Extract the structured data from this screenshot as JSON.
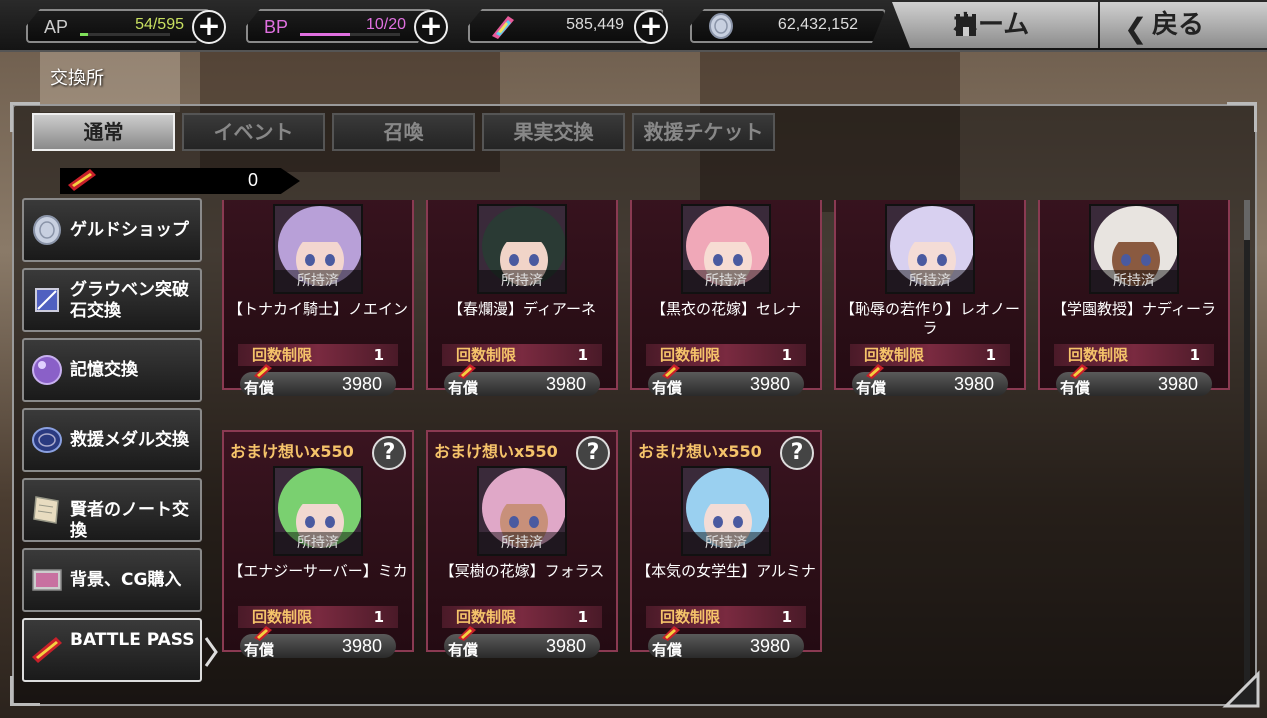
{
  "topbar": {
    "ap": {
      "label": "AP",
      "value": "54/595",
      "color": "#7fe05a",
      "fill": 0.09
    },
    "bp": {
      "label": "BP",
      "value": "10/20",
      "color": "#e070e0",
      "fill": 0.5
    },
    "gems": {
      "value": "585,449",
      "icon": "crystal-icon"
    },
    "gold": {
      "value": "62,432,152",
      "icon": "coin-icon"
    },
    "home_label": "ホーム",
    "back_label": "戻る",
    "plus_label": "+"
  },
  "page_title": "交換所",
  "tabs": [
    {
      "label": "通常",
      "active": true
    },
    {
      "label": "イベント",
      "active": false
    },
    {
      "label": "召喚",
      "active": false
    },
    {
      "label": "果実交換",
      "active": false
    },
    {
      "label": "救援チケット",
      "active": false
    }
  ],
  "ticket": {
    "count": "0",
    "icon": "battle-pass-ticket-icon"
  },
  "sidebar": [
    {
      "label": "ゲルドショップ",
      "icon": "coin-icon"
    },
    {
      "label": "グラウベン突破石交換",
      "icon": "break-stone-icon"
    },
    {
      "label": "記憶交換",
      "icon": "memory-orb-icon"
    },
    {
      "label": "救援メダル交換",
      "icon": "medal-icon"
    },
    {
      "label": "賢者のノート交換",
      "icon": "note-icon"
    },
    {
      "label": "背景、CG購入",
      "icon": "picture-icon"
    },
    {
      "label": "BATTLE PASS",
      "icon": "battle-pass-ticket-icon",
      "active": true
    }
  ],
  "cards": [
    {
      "name": "【トナカイ騎士】ノエイン",
      "owned": "所持済",
      "limit_label": "回数制限",
      "limit": "1",
      "price_type": "有償",
      "price": "3980",
      "bonus": "",
      "hair": "#b8a0d8",
      "skin": "#f3d6cf"
    },
    {
      "name": "【春爛漫】ディアーネ",
      "owned": "所持済",
      "limit_label": "回数制限",
      "limit": "1",
      "price_type": "有償",
      "price": "3980",
      "bonus": "",
      "hair": "#2a3a34",
      "skin": "#f1d4c8"
    },
    {
      "name": "【黒衣の花嫁】セレナ",
      "owned": "所持済",
      "limit_label": "回数制限",
      "limit": "1",
      "price_type": "有償",
      "price": "3980",
      "bonus": "",
      "hair": "#f0a8b8",
      "skin": "#f7dcd3"
    },
    {
      "name": "【恥辱の若作り】レオノーラ",
      "owned": "所持済",
      "limit_label": "回数制限",
      "limit": "1",
      "price_type": "有償",
      "price": "3980",
      "bonus": "",
      "hair": "#d8d0f0",
      "skin": "#f4dcd6"
    },
    {
      "name": "【学園教授】ナディーラ",
      "owned": "所持済",
      "limit_label": "回数制限",
      "limit": "1",
      "price_type": "有償",
      "price": "3980",
      "bonus": "",
      "hair": "#e8e4e0",
      "skin": "#8a5a40"
    },
    {
      "name": "【エナジーサーバー】ミカ",
      "owned": "所持済",
      "limit_label": "回数制限",
      "limit": "1",
      "price_type": "有償",
      "price": "3980",
      "bonus": "おまけ想いx550",
      "help": "?",
      "hair": "#7ad070",
      "skin": "#f1d8d0"
    },
    {
      "name": "【冥樹の花嫁】フォラス",
      "owned": "所持済",
      "limit_label": "回数制限",
      "limit": "1",
      "price_type": "有償",
      "price": "3980",
      "bonus": "おまけ想いx550",
      "help": "?",
      "hair": "#e0a8c8",
      "skin": "#c8907a"
    },
    {
      "name": "【本気の女学生】アルミナ",
      "owned": "所持済",
      "limit_label": "回数制限",
      "limit": "1",
      "price_type": "有償",
      "price": "3980",
      "bonus": "おまけ想いx550",
      "help": "?",
      "hair": "#9ad0f0",
      "skin": "#f3dcd6"
    }
  ]
}
